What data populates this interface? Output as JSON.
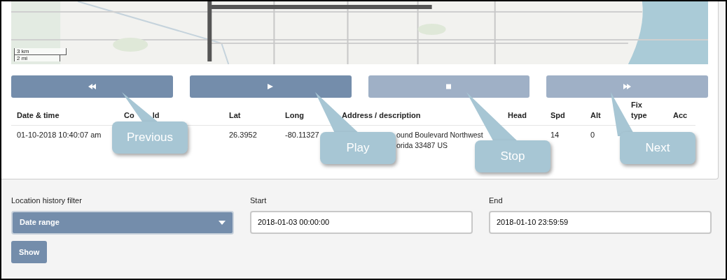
{
  "map": {
    "kind": "picture",
    "scale": [
      "3 km",
      "2 mi"
    ]
  },
  "controls": [
    {
      "kind": "rewind",
      "disabled": false
    },
    {
      "kind": "play",
      "disabled": false
    },
    {
      "kind": "stop",
      "disabled": true
    },
    {
      "kind": "forward",
      "disabled": true
    }
  ],
  "table": {
    "columns": [
      {
        "parts": [
          "Date & time"
        ]
      },
      {
        "parts": [
          "Co",
          "ld"
        ]
      },
      {
        "parts": [
          "Lat"
        ]
      },
      {
        "parts": [
          "Long"
        ]
      },
      {
        "parts": [
          "Address / description"
        ]
      },
      {
        "parts": [
          "Head"
        ]
      },
      {
        "parts": [
          "Spd"
        ]
      },
      {
        "parts": [
          "Alt"
        ]
      },
      {
        "parts": [
          "Fix",
          "type"
        ]
      },
      {
        "parts": [
          "Acc"
        ]
      }
    ],
    "rows": [
      {
        "cells": [
          [
            "01-10-2018 10:40:07 am"
          ],
          [],
          [
            "26.3952"
          ],
          [
            "-80.11327"
          ],
          [
            "ound Boulevard Northwest",
            "orida 33487 US"
          ],
          [],
          [
            "14"
          ],
          [
            "0"
          ],
          [],
          []
        ]
      }
    ]
  },
  "callouts": [
    "Previous",
    "Play",
    "Stop",
    "Next"
  ],
  "filter": {
    "label": "Location history filter",
    "value": "Date range",
    "start_label": "Start",
    "start": "2018-01-03 00:00:00",
    "end_label": "End",
    "end": "2018-01-10 23:59:59",
    "button": "Show"
  }
}
